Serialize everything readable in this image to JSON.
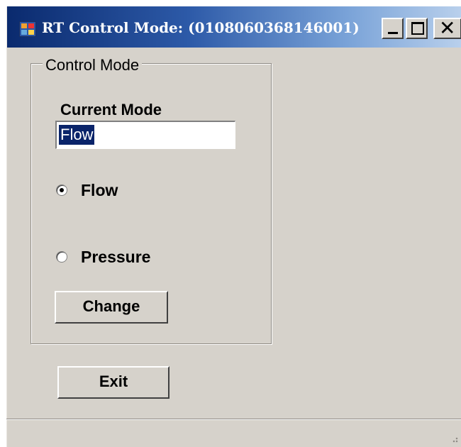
{
  "window": {
    "title": "RT Control Mode: (0108060368146001)",
    "icon": "application-icon"
  },
  "caption_buttons": {
    "minimize": "minimize-icon",
    "maximize": "maximize-icon",
    "close": "close-icon"
  },
  "group": {
    "label": "Control Mode",
    "current_mode_label": "Current Mode",
    "current_mode_value": "Flow",
    "options": [
      {
        "label": "Flow",
        "checked": true
      },
      {
        "label": "Pressure",
        "checked": false
      }
    ],
    "change_label": "Change"
  },
  "exit_label": "Exit",
  "colors": {
    "face": "#d6d2cb",
    "title_start": "#0a2a6e",
    "title_end": "#b9d0ec",
    "selection": "#0a246a"
  }
}
